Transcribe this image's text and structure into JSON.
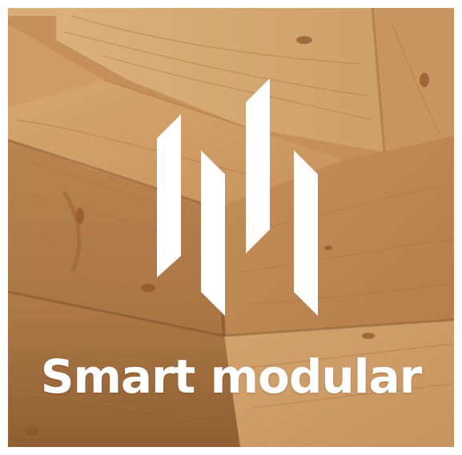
{
  "brand": {
    "name": "Smart modular",
    "logo_icon": "vertical-slanted-bars-logo-icon",
    "text_color": "#ffffff"
  },
  "background": {
    "subject": "stacked-timber-blocks",
    "colors": {
      "light_wood": "#d9aa76",
      "mid_wood": "#c48f5a",
      "dark_wood": "#9c6a3c",
      "shadow": "#7a4e2a"
    }
  }
}
